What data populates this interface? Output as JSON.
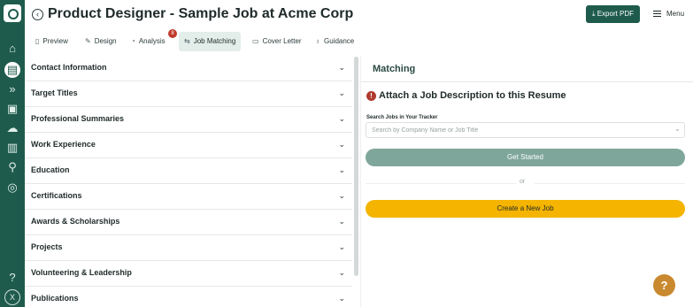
{
  "rail": {
    "items": [
      {
        "icon": "home-icon",
        "glyph": "⌂"
      },
      {
        "icon": "resume-icon",
        "glyph": "▤"
      },
      {
        "icon": "chevrons-right-icon",
        "glyph": "»"
      },
      {
        "icon": "contacts-icon",
        "glyph": "▣"
      },
      {
        "icon": "cloud-icon",
        "glyph": "☁"
      },
      {
        "icon": "building-icon",
        "glyph": "▥"
      },
      {
        "icon": "search-icon",
        "glyph": "⚲"
      },
      {
        "icon": "target-icon",
        "glyph": "◎"
      },
      {
        "icon": "help-icon",
        "glyph": "?"
      }
    ],
    "avatar_text": "X"
  },
  "header": {
    "title": "Product Designer - Sample Job at Acme Corp",
    "export_label": "Export PDF",
    "menu_label": "Menu"
  },
  "tabs": [
    {
      "label": "Preview",
      "icon": "document-icon"
    },
    {
      "label": "Design",
      "icon": "pencil-icon"
    },
    {
      "label": "Analysis",
      "icon": "gauge-icon",
      "badge": "8"
    },
    {
      "label": "Job Matching",
      "icon": "arrows-icon",
      "active": true
    },
    {
      "label": "Cover Letter",
      "icon": "note-icon"
    },
    {
      "label": "Guidance",
      "icon": "lightbulb-icon"
    }
  ],
  "sections": [
    "Contact Information",
    "Target Titles",
    "Professional Summaries",
    "Work Experience",
    "Education",
    "Certifications",
    "Awards & Scholarships",
    "Projects",
    "Volunteering & Leadership",
    "Publications"
  ],
  "matching": {
    "title": "Matching",
    "attach_title": "Attach a Job Description to this Resume",
    "search_label": "Search Jobs in Your Tracker",
    "search_placeholder": "Search by Company Name or Job Title",
    "get_started_label": "Get Started",
    "or_text": "or",
    "create_label": "Create a New Job"
  },
  "help_button_label": "?",
  "colors": {
    "brand": "#1e5b4d",
    "get_started": "#7fa69a",
    "create_button": "#f4b400",
    "badge": "#c0392b",
    "help_button": "#c9892f"
  }
}
